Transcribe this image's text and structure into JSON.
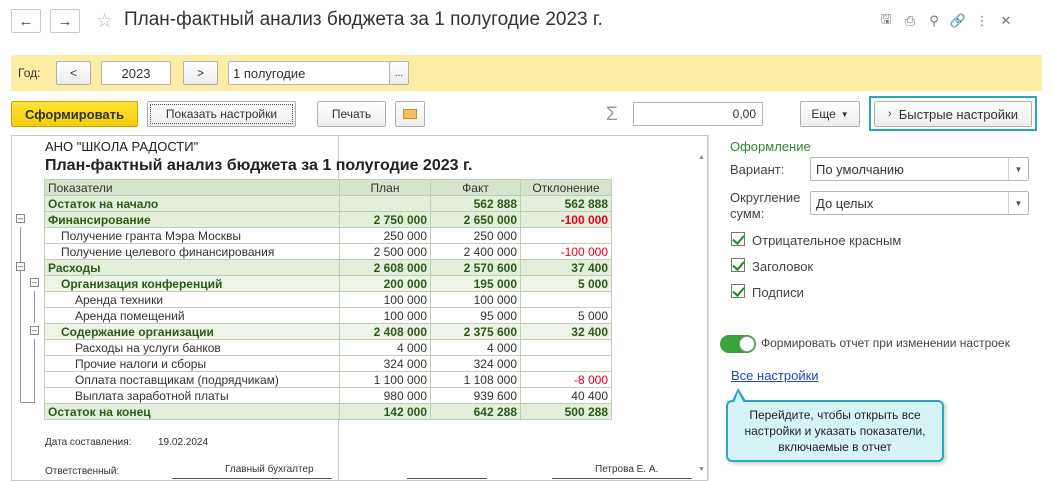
{
  "window": {
    "title": "План-фактный анализ бюджета за 1 полугодие 2023 г.",
    "icons": [
      "save-icon",
      "print-icon",
      "preview-icon",
      "link-icon",
      "more-icon",
      "close-icon"
    ]
  },
  "params": {
    "year_label": "Год:",
    "prev": "<",
    "year": "2023",
    "next": ">",
    "period": "1 полугодие",
    "period_pick": "..."
  },
  "toolbar": {
    "generate": "Сформировать",
    "show_settings": "Показать настройки",
    "print": "Печать",
    "sum": "0,00",
    "more": "Еще",
    "quick_settings": "Быстрые настройки"
  },
  "report": {
    "org": "АНО \"ШКОЛА РАДОСТИ\"",
    "title": "План-фактный анализ бюджета за 1 полугодие 2023 г.",
    "columns": [
      "Показатели",
      "План",
      "Факт",
      "Отклонение"
    ],
    "rows": [
      {
        "name": "Остаток на начало",
        "plan": "",
        "fact": "562 888",
        "dev": "562 888",
        "level": "top",
        "dev_neg": false
      },
      {
        "name": "Финансирование",
        "plan": "2 750 000",
        "fact": "2 650 000",
        "dev": "-100 000",
        "level": "top",
        "dev_neg": true
      },
      {
        "name": "Получение гранта Мэра Москвы",
        "plan": "250 000",
        "fact": "250 000",
        "dev": "",
        "level": "item1",
        "dev_neg": false
      },
      {
        "name": "Получение целевого финансирования",
        "plan": "2 500 000",
        "fact": "2 400 000",
        "dev": "-100 000",
        "level": "item1",
        "dev_neg": true
      },
      {
        "name": "Расходы",
        "plan": "2 608 000",
        "fact": "2 570 600",
        "dev": "37 400",
        "level": "top",
        "dev_neg": false
      },
      {
        "name": "Организация конференций",
        "plan": "200 000",
        "fact": "195 000",
        "dev": "5 000",
        "level": "sub",
        "dev_neg": false
      },
      {
        "name": "Аренда техники",
        "plan": "100 000",
        "fact": "100 000",
        "dev": "",
        "level": "item2",
        "dev_neg": false
      },
      {
        "name": "Аренда помещений",
        "plan": "100 000",
        "fact": "95 000",
        "dev": "5 000",
        "level": "item2",
        "dev_neg": false
      },
      {
        "name": "Содержание организации",
        "plan": "2 408 000",
        "fact": "2 375 600",
        "dev": "32 400",
        "level": "sub",
        "dev_neg": false
      },
      {
        "name": "Расходы на услуги банков",
        "plan": "4 000",
        "fact": "4 000",
        "dev": "",
        "level": "item2",
        "dev_neg": false
      },
      {
        "name": "Прочие налоги и сборы",
        "plan": "324 000",
        "fact": "324 000",
        "dev": "",
        "level": "item2",
        "dev_neg": false
      },
      {
        "name": "Оплата поставщикам (подрядчикам)",
        "plan": "1 100 000",
        "fact": "1 108 000",
        "dev": "-8 000",
        "level": "item2",
        "dev_neg": true
      },
      {
        "name": "Выплата заработной платы",
        "plan": "980 000",
        "fact": "939 600",
        "dev": "40 400",
        "level": "item2",
        "dev_neg": false
      },
      {
        "name": "Остаток на конец",
        "plan": "142 000",
        "fact": "642 288",
        "dev": "500 288",
        "level": "top",
        "dev_neg": false
      }
    ],
    "date_label": "Дата составления:",
    "date": "19.02.2024",
    "resp_label": "Ответственный:",
    "position": "Главный бухгалтер",
    "person": "Петрова Е. А."
  },
  "settings": {
    "section": "Оформление",
    "variant_label": "Вариант:",
    "variant": "По умолчанию",
    "round_label_1": "Округление",
    "round_label_2": "сумм:",
    "round": "До целых",
    "checkboxes": [
      "Отрицательное красным",
      "Заголовок",
      "Подписи"
    ],
    "toggle_label": "Формировать отчет при изменении настроек",
    "all_settings": "Все настройки",
    "tooltip": "Перейдите, чтобы открыть все настройки и указать показатели, включаемые в отчет"
  }
}
